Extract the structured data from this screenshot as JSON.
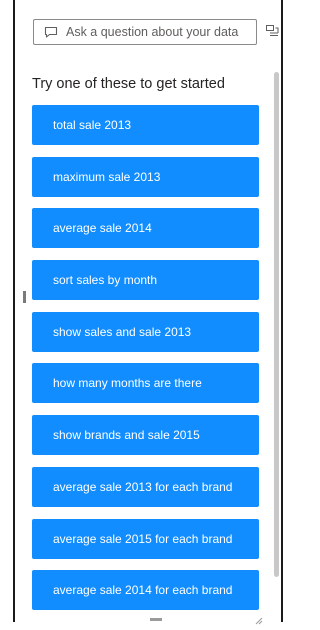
{
  "qa": {
    "placeholder": "Ask a question about your data",
    "input_icon": "chat-bubble-icon",
    "side_icon": "expand-panel-icon"
  },
  "heading": "Try one of these to get started",
  "suggestions": [
    "total sale 2013",
    "maximum sale 2013",
    "average sale 2014",
    "sort sales by month",
    "show sales and sale 2013",
    "how many months are there",
    "show brands and sale 2015",
    "average sale 2013 for each brand",
    "average sale 2015 for each brand",
    "average sale 2014 for each brand"
  ],
  "colors": {
    "suggestion_bg": "#118dff",
    "suggestion_text": "#ffffff",
    "heading": "#252423"
  }
}
